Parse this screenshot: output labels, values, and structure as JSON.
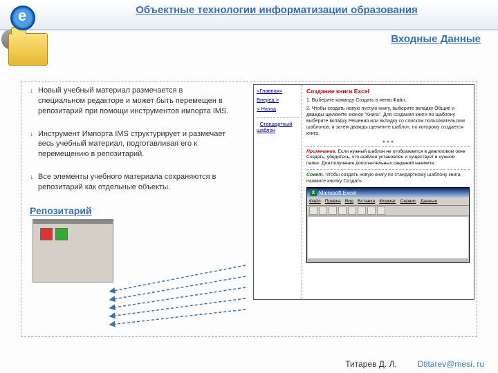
{
  "header": {
    "title": "Объектные технологии информатизации образования",
    "subtitle": "Входные Данные"
  },
  "bullets": {
    "item1": "Новый учебный материал размечается в специальном редакторе и может быть перемещен в репозитарий при помощи инструментов импорта IMS.",
    "item2": "Инструмент Импорта IMS структурирует и размечает весь учебный материал, подготавливая его к перемещению в репозитарий.",
    "item3": "Все элементы учебного материала сохраняются в репозитарий как отдельные объекты.",
    "repoLabel": "Репозитарий"
  },
  "browser": {
    "nav": {
      "home": "<Главная>",
      "fwd": "Вперед >",
      "back": "< Назад",
      "std": "Стандартный шаблон"
    },
    "main": {
      "title": "Создание книги Excel",
      "step1": "1. Выберите команду Создать в меню Файл.",
      "step2": "2. Чтобы создать новую пустую книгу, выберите вкладку Общие и дважды щелкните значок \"Книга\". Для создания книги по шаблону выберите вкладку Решения или вкладку со списком пользовательских шаблонов, а затем дважды щелкните шаблон, по которому создается книга.",
      "divider": "« « «",
      "noteLabel": "Примечание.",
      "noteText": " Если нужный шаблон не отображается в диалоговом окне Создать, убедитесь, что шаблон установлен и существует в нужной папке. Для получения дополнительных сведений нажмите.",
      "tipLabel": "Совет.",
      "tipText": " Чтобы создать новую книгу по стандартному шаблону книга, нажмите кнопку Создать"
    },
    "excel": {
      "appName": "Microsoft Excel",
      "menus": {
        "file": "Файл",
        "edit": "Правка",
        "view": "Вид",
        "insert": "Вставка",
        "format": "Формат",
        "tools": "Сервис",
        "data": "Данные"
      }
    }
  },
  "footer": {
    "author": "Титарев Д. Л.",
    "email": "Dtitarev@mesi. ru"
  }
}
